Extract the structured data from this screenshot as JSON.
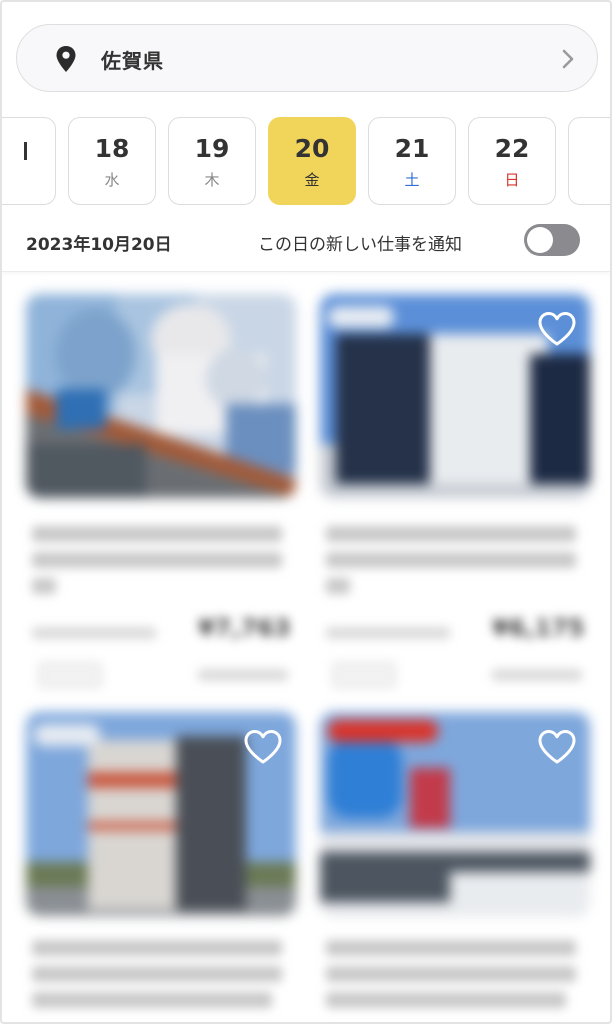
{
  "location": {
    "prefecture": "佐賀県",
    "pin_icon": "location-pin-icon",
    "chevron_icon": "chevron-right-icon"
  },
  "dates": [
    {
      "day": "",
      "weekday": "",
      "partial": true
    },
    {
      "day": "18",
      "weekday": "水"
    },
    {
      "day": "19",
      "weekday": "木"
    },
    {
      "day": "20",
      "weekday": "金",
      "selected": true
    },
    {
      "day": "21",
      "weekday": "土",
      "type": "saturday"
    },
    {
      "day": "22",
      "weekday": "日",
      "type": "sunday"
    },
    {
      "day": "",
      "weekday": "",
      "partial": true
    }
  ],
  "selected_date_label": "2023年10月20日",
  "notify": {
    "label": "この日の新しい仕事を通知",
    "enabled": false
  },
  "colors": {
    "selected_date": "#f1d55b",
    "saturday": "#2f6fd6",
    "sunday": "#d9342b",
    "toggle_off": "#8a8a8f"
  },
  "jobs": [
    {
      "price": "¥7,763",
      "favorite_icon": "heart-outline-icon",
      "image": "workers-on-conveyor"
    },
    {
      "price": "¥6,175",
      "favorite_icon": "heart-outline-icon",
      "image": "warehouse-building"
    },
    {
      "price": "",
      "favorite_icon": "heart-outline-icon",
      "image": "office-building"
    },
    {
      "price": "",
      "favorite_icon": "heart-outline-icon",
      "image": "store-building"
    }
  ]
}
